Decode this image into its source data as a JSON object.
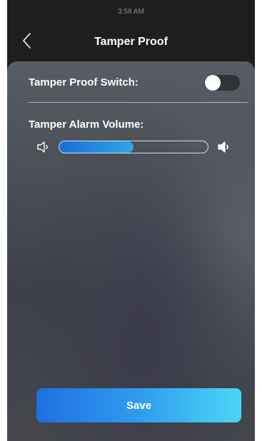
{
  "status_bar": {
    "time": "3:58 AM"
  },
  "header": {
    "title": "Tamper Proof",
    "back_icon": "chevron-left-icon"
  },
  "settings": {
    "switch_label": "Tamper Proof Switch:",
    "switch_on": false,
    "volume_label": "Tamper Alarm Volume:",
    "volume_level": 0.5,
    "volume_down_icon": "speaker-low-icon",
    "volume_up_icon": "speaker-high-icon"
  },
  "actions": {
    "save_label": "Save"
  },
  "colors": {
    "accent_start": "#1f6fe0",
    "accent_end": "#4cd6f6",
    "header_bg": "#1e1e1e"
  }
}
